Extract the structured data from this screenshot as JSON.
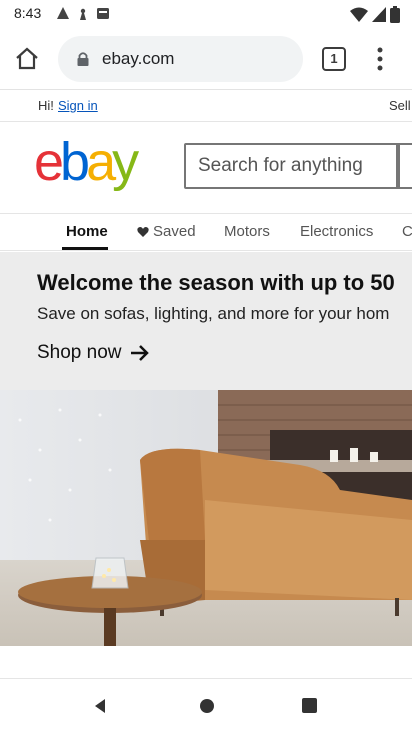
{
  "status_bar": {
    "time": "8:43",
    "left_icons": [
      "alert-icon",
      "signal-tower-icon",
      "calendar-icon"
    ],
    "right_icons": [
      "wifi-icon",
      "cell-signal-icon",
      "battery-icon"
    ]
  },
  "browser": {
    "url": "ebay.com",
    "tab_count": "1"
  },
  "header": {
    "greeting": "Hi!",
    "sign_in": "Sign in",
    "sell": "Sell",
    "logo_text": "ebay",
    "search_placeholder": "Search for anything"
  },
  "nav": {
    "items": [
      {
        "label": "Home",
        "active": true
      },
      {
        "label": "Saved",
        "active": false
      },
      {
        "label": "Motors",
        "active": false
      },
      {
        "label": "Electronics",
        "active": false
      },
      {
        "label": "C",
        "active": false
      }
    ]
  },
  "banner": {
    "title": "Welcome the season with up to 50",
    "subtitle": "Save on sofas, lighting, and more for your hom",
    "cta": "Shop now"
  },
  "colors": {
    "ebay_red": "#e53238",
    "ebay_blue": "#0064d2",
    "ebay_yellow": "#f5af02",
    "ebay_green": "#86b817",
    "link_blue": "#0654ba"
  }
}
